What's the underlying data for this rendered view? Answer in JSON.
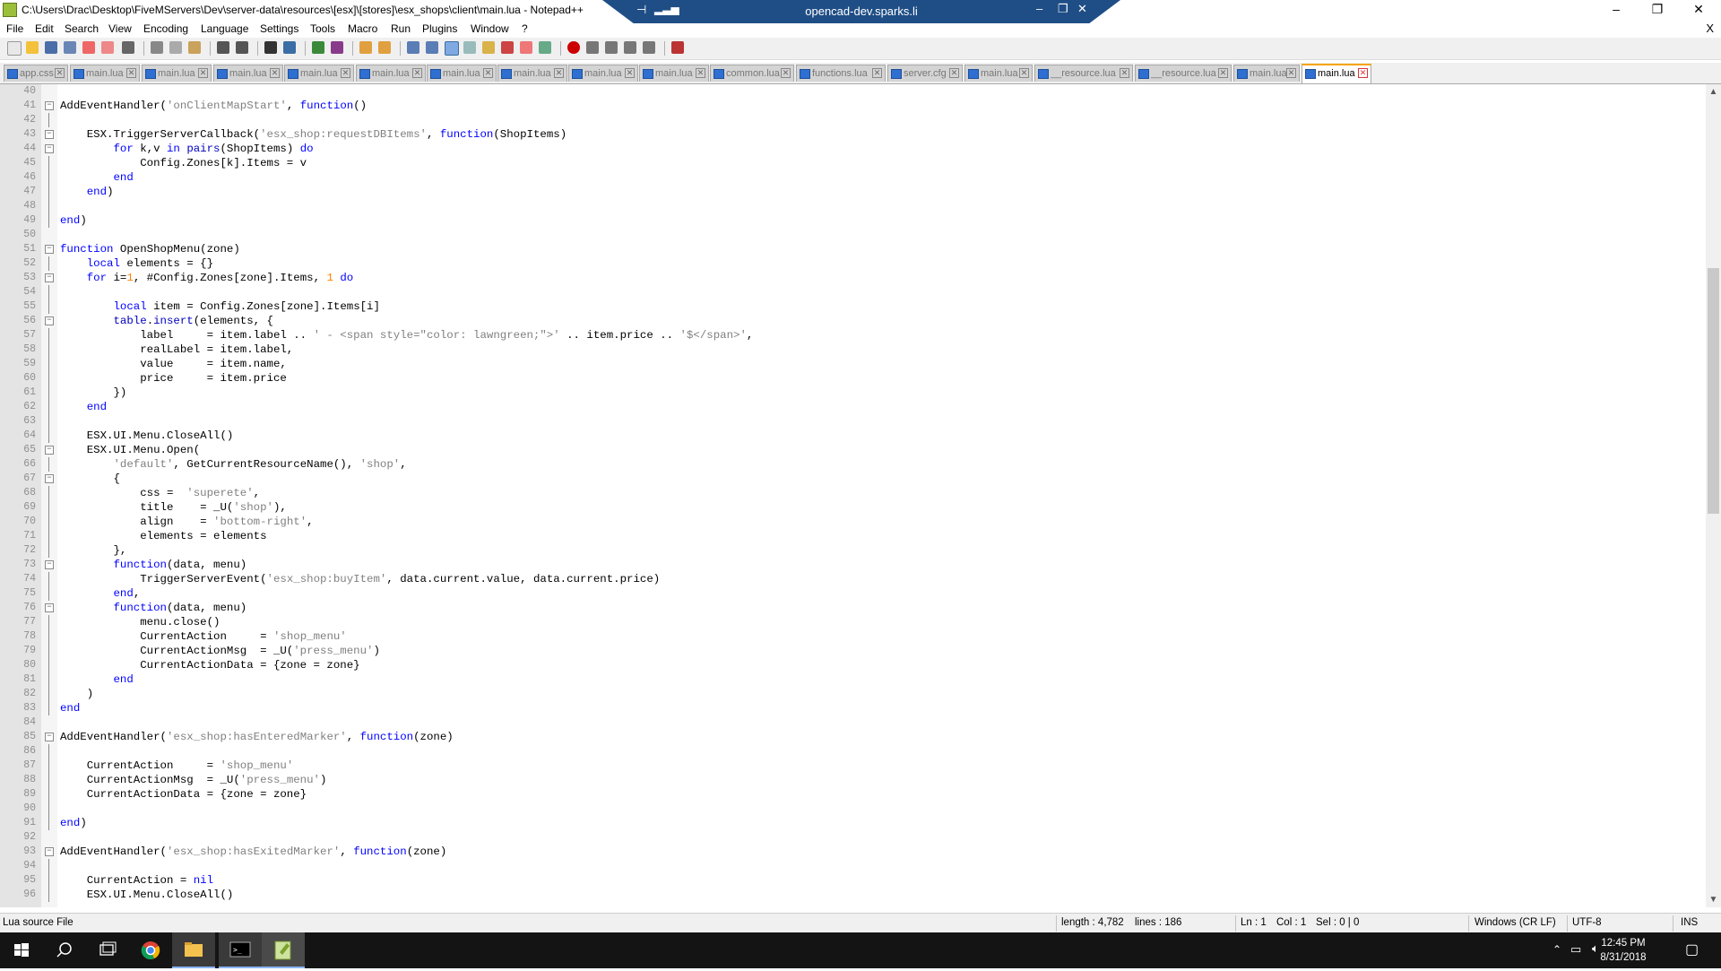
{
  "window": {
    "title": "C:\\Users\\Drac\\Desktop\\FiveMServers\\Dev\\server-data\\resources\\[esx]\\[stores]\\esx_shops\\client\\main.lua - Notepad++",
    "remote_host": "opencad-dev.sparks.li",
    "minimize": "–",
    "maximize": "❐",
    "close": "✕",
    "doc_close": "X"
  },
  "menu": [
    "File",
    "Edit",
    "Search",
    "View",
    "Encoding",
    "Language",
    "Settings",
    "Tools",
    "Macro",
    "Run",
    "Plugins",
    "Window",
    "?"
  ],
  "tabs": [
    {
      "label": "app.css",
      "active": false
    },
    {
      "label": "main.lua",
      "active": false
    },
    {
      "label": "main.lua",
      "active": false
    },
    {
      "label": "main.lua",
      "active": false
    },
    {
      "label": "main.lua",
      "active": false
    },
    {
      "label": "main.lua",
      "active": false
    },
    {
      "label": "main.lua",
      "active": false
    },
    {
      "label": "main.lua",
      "active": false
    },
    {
      "label": "main.lua",
      "active": false
    },
    {
      "label": "main.lua",
      "active": false
    },
    {
      "label": "common.lua",
      "active": false
    },
    {
      "label": "functions.lua",
      "active": false
    },
    {
      "label": "server.cfg",
      "active": false
    },
    {
      "label": "main.lua",
      "active": false
    },
    {
      "label": "__resource.lua",
      "active": false
    },
    {
      "label": "__resource.lua",
      "active": false
    },
    {
      "label": "main.lua",
      "active": false
    },
    {
      "label": "main.lua",
      "active": true
    }
  ],
  "editor": {
    "lines": [
      {
        "n": "40",
        "t": ""
      },
      {
        "n": "41",
        "t": "AddEventHandler('onClientMapStart', function()"
      },
      {
        "n": "42",
        "t": ""
      },
      {
        "n": "43",
        "t": "    ESX.TriggerServerCallback('esx_shop:requestDBItems', function(ShopItems)"
      },
      {
        "n": "44",
        "t": "        for k,v in pairs(ShopItems) do"
      },
      {
        "n": "45",
        "t": "            Config.Zones[k].Items = v"
      },
      {
        "n": "46",
        "t": "        end"
      },
      {
        "n": "47",
        "t": "    end)"
      },
      {
        "n": "48",
        "t": ""
      },
      {
        "n": "49",
        "t": "end)"
      },
      {
        "n": "50",
        "t": ""
      },
      {
        "n": "51",
        "t": "function OpenShopMenu(zone)"
      },
      {
        "n": "52",
        "t": "    local elements = {}"
      },
      {
        "n": "53",
        "t": "    for i=1, #Config.Zones[zone].Items, 1 do"
      },
      {
        "n": "54",
        "t": ""
      },
      {
        "n": "55",
        "t": "        local item = Config.Zones[zone].Items[i]"
      },
      {
        "n": "56",
        "t": "        table.insert(elements, {"
      },
      {
        "n": "57",
        "t": "            label     = item.label .. ' - <span style=\"color: lawngreen;\">' .. item.price .. '$</span>',"
      },
      {
        "n": "58",
        "t": "            realLabel = item.label,"
      },
      {
        "n": "59",
        "t": "            value     = item.name,"
      },
      {
        "n": "60",
        "t": "            price     = item.price"
      },
      {
        "n": "61",
        "t": "        })"
      },
      {
        "n": "62",
        "t": "    end"
      },
      {
        "n": "63",
        "t": ""
      },
      {
        "n": "64",
        "t": "    ESX.UI.Menu.CloseAll()"
      },
      {
        "n": "65",
        "t": "    ESX.UI.Menu.Open("
      },
      {
        "n": "66",
        "t": "        'default', GetCurrentResourceName(), 'shop',"
      },
      {
        "n": "67",
        "t": "        {"
      },
      {
        "n": "68",
        "t": "            css =  'superete',"
      },
      {
        "n": "69",
        "t": "            title    = _U('shop'),"
      },
      {
        "n": "70",
        "t": "            align    = 'bottom-right',"
      },
      {
        "n": "71",
        "t": "            elements = elements"
      },
      {
        "n": "72",
        "t": "        },"
      },
      {
        "n": "73",
        "t": "        function(data, menu)"
      },
      {
        "n": "74",
        "t": "            TriggerServerEvent('esx_shop:buyItem', data.current.value, data.current.price)"
      },
      {
        "n": "75",
        "t": "        end,"
      },
      {
        "n": "76",
        "t": "        function(data, menu)"
      },
      {
        "n": "77",
        "t": "            menu.close()"
      },
      {
        "n": "78",
        "t": "            CurrentAction     = 'shop_menu'"
      },
      {
        "n": "79",
        "t": "            CurrentActionMsg  = _U('press_menu')"
      },
      {
        "n": "80",
        "t": "            CurrentActionData = {zone = zone}"
      },
      {
        "n": "81",
        "t": "        end"
      },
      {
        "n": "82",
        "t": "    )"
      },
      {
        "n": "83",
        "t": "end"
      },
      {
        "n": "84",
        "t": ""
      },
      {
        "n": "85",
        "t": "AddEventHandler('esx_shop:hasEnteredMarker', function(zone)"
      },
      {
        "n": "86",
        "t": ""
      },
      {
        "n": "87",
        "t": "    CurrentAction     = 'shop_menu'"
      },
      {
        "n": "88",
        "t": "    CurrentActionMsg  = _U('press_menu')"
      },
      {
        "n": "89",
        "t": "    CurrentActionData = {zone = zone}"
      },
      {
        "n": "90",
        "t": ""
      },
      {
        "n": "91",
        "t": "end)"
      },
      {
        "n": "92",
        "t": ""
      },
      {
        "n": "93",
        "t": "AddEventHandler('esx_shop:hasExitedMarker', function(zone)"
      },
      {
        "n": "94",
        "t": ""
      },
      {
        "n": "95",
        "t": "    CurrentAction = nil"
      },
      {
        "n": "96",
        "t": "    ESX.UI.Menu.CloseAll()"
      }
    ]
  },
  "status": {
    "filetype": "Lua source File",
    "length": "length : 4,782",
    "lines": "lines : 186",
    "ln": "Ln : 1",
    "col": "Col : 1",
    "sel": "Sel : 0 | 0",
    "eol": "Windows (CR LF)",
    "encoding": "UTF-8",
    "mode": "INS"
  },
  "taskbar": {
    "time": "12:45 PM",
    "date": "8/31/2018"
  },
  "colors": {
    "keyword": "#0000ff",
    "string": "#808080",
    "number": "#ff8000",
    "active_tab_accent": "#f7a400",
    "remote_bar": "#1f4e86",
    "taskbar": "#141414"
  }
}
